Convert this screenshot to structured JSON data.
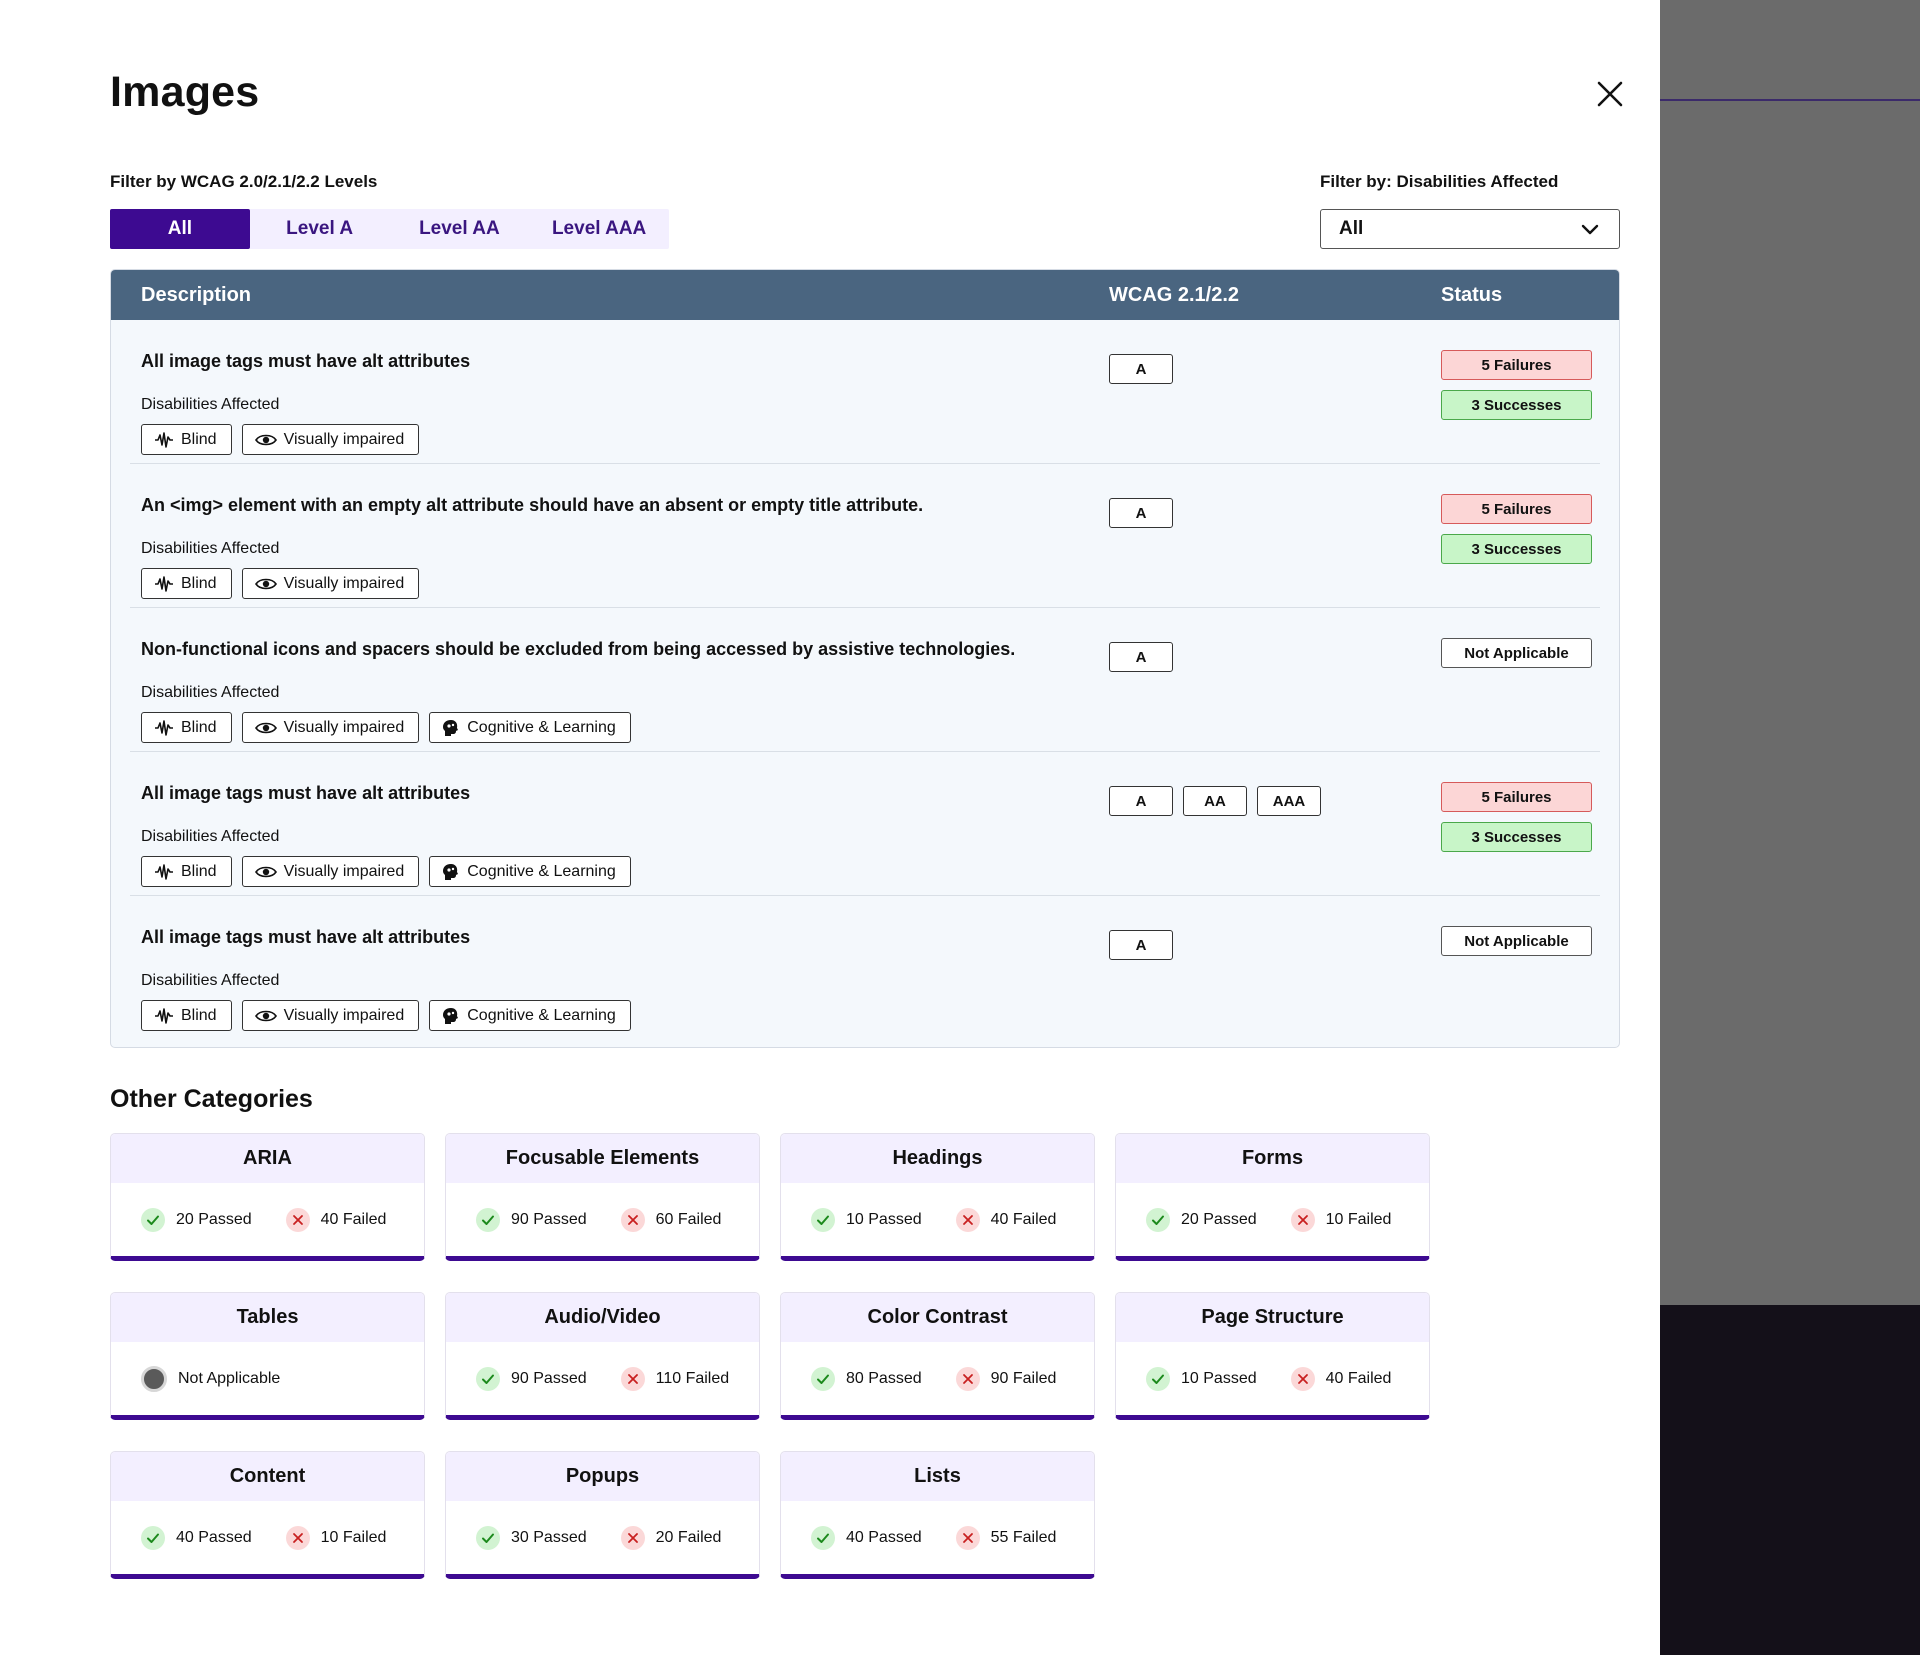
{
  "title": "Images",
  "close_label": "close",
  "filters": {
    "levels_label": "Filter by WCAG 2.0/2.1/2.2 Levels",
    "tabs": [
      "All",
      "Level A",
      "Level AA",
      "Level AAA"
    ],
    "active_tab": "All",
    "disabilities_label": "Filter by: Disabilities Affected",
    "disabilities_value": "All"
  },
  "table": {
    "headers": {
      "description": "Description",
      "wcag": "WCAG 2.1/2.2",
      "status": "Status"
    },
    "disabilities_label": "Disabilities Affected",
    "rows": [
      {
        "description": "All image tags must have alt attributes",
        "disabilities": [
          {
            "label": "Blind",
            "icon": "blind-icon"
          },
          {
            "label": "Visually impaired",
            "icon": "eye-icon"
          }
        ],
        "levels": [
          "A"
        ],
        "status": [
          {
            "type": "fail",
            "label": "5 Failures"
          },
          {
            "type": "success",
            "label": "3 Successes"
          }
        ]
      },
      {
        "description": "An <img> element with an empty alt attribute should have an absent or empty title attribute.",
        "disabilities": [
          {
            "label": "Blind",
            "icon": "blind-icon"
          },
          {
            "label": "Visually impaired",
            "icon": "eye-icon"
          }
        ],
        "levels": [
          "A"
        ],
        "status": [
          {
            "type": "fail",
            "label": "5 Failures"
          },
          {
            "type": "success",
            "label": "3 Successes"
          }
        ]
      },
      {
        "description": "Non-functional icons and spacers should be excluded from being accessed by assistive technologies.",
        "disabilities": [
          {
            "label": "Blind",
            "icon": "blind-icon"
          },
          {
            "label": "Visually impaired",
            "icon": "eye-icon"
          },
          {
            "label": "Cognitive & Learning",
            "icon": "brain-icon"
          }
        ],
        "levels": [
          "A"
        ],
        "status": [
          {
            "type": "na",
            "label": "Not Applicable"
          }
        ]
      },
      {
        "description": "All image tags must have alt attributes",
        "disabilities": [
          {
            "label": "Blind",
            "icon": "blind-icon"
          },
          {
            "label": "Visually impaired",
            "icon": "eye-icon"
          },
          {
            "label": "Cognitive & Learning",
            "icon": "brain-icon"
          }
        ],
        "levels": [
          "A",
          "AA",
          "AAA"
        ],
        "status": [
          {
            "type": "fail",
            "label": "5 Failures"
          },
          {
            "type": "success",
            "label": "3 Successes"
          }
        ]
      },
      {
        "description": "All image tags must have alt attributes",
        "disabilities": [
          {
            "label": "Blind",
            "icon": "blind-icon"
          },
          {
            "label": "Visually impaired",
            "icon": "eye-icon"
          },
          {
            "label": "Cognitive & Learning",
            "icon": "brain-icon"
          }
        ],
        "levels": [
          "A"
        ],
        "status": [
          {
            "type": "na",
            "label": "Not Applicable"
          }
        ]
      }
    ]
  },
  "other_categories": {
    "title": "Other Categories",
    "items": [
      {
        "name": "ARIA",
        "passed": "20 Passed",
        "failed": "40 Failed"
      },
      {
        "name": "Focusable Elements",
        "passed": "90 Passed",
        "failed": "60 Failed"
      },
      {
        "name": "Headings",
        "passed": "10 Passed",
        "failed": "40 Failed"
      },
      {
        "name": "Forms",
        "passed": "20 Passed",
        "failed": "10 Failed"
      },
      {
        "name": "Tables",
        "not_applicable": "Not Applicable"
      },
      {
        "name": "Audio/Video",
        "passed": "90 Passed",
        "failed": "110 Failed"
      },
      {
        "name": "Color Contrast",
        "passed": "80 Passed",
        "failed": "90 Failed"
      },
      {
        "name": "Page Structure",
        "passed": "10 Passed",
        "failed": "40 Failed"
      },
      {
        "name": "Content",
        "passed": "40 Passed",
        "failed": "10 Failed"
      },
      {
        "name": "Popups",
        "passed": "30 Passed",
        "failed": "20 Failed"
      },
      {
        "name": "Lists",
        "passed": "40 Passed",
        "failed": "55 Failed"
      }
    ]
  },
  "colors": {
    "accent": "#3d0a91",
    "header_bg": "#4a6580",
    "fail_bg": "#fcd6d6",
    "success_bg": "#c8f5c8"
  }
}
